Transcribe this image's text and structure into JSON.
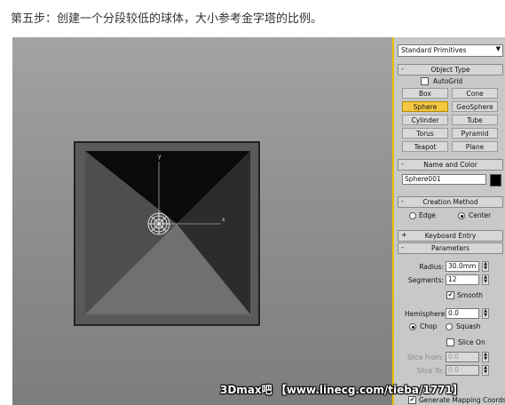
{
  "caption": "第五步：创建一个分段较低的球体，大小参考金字塔的比例。",
  "watermark": "3Dmax吧 【www.linecg.com/tieba/1771】",
  "viewport": {
    "axis_y": "y",
    "axis_x": "x"
  },
  "panel": {
    "dropdown": "Standard Primitives",
    "object_type": {
      "title": "Object Type",
      "autogrid": "AutoGrid",
      "buttons": [
        "Box",
        "Cone",
        "Sphere",
        "GeoSphere",
        "Cylinder",
        "Tube",
        "Torus",
        "Pyramid",
        "Teapot",
        "Plane"
      ],
      "active": "Sphere"
    },
    "name_color": {
      "title": "Name and Color",
      "name": "Sphere001",
      "color": "#000000"
    },
    "creation_method": {
      "title": "Creation Method",
      "edge": "Edge",
      "center": "Center",
      "selected": "Center"
    },
    "keyboard_entry": {
      "title": "Keyboard Entry"
    },
    "parameters": {
      "title": "Parameters",
      "radius_label": "Radius:",
      "radius": "30.0mm",
      "segments_label": "Segments:",
      "segments": "12",
      "smooth": "Smooth",
      "hemisphere_label": "Hemisphere:",
      "hemisphere": "0.0",
      "chop": "Chop",
      "squash": "Squash",
      "slice_on": "Slice On",
      "slice_from_label": "Slice From:",
      "slice_from": "0.0",
      "slice_to_label": "Slice To:",
      "slice_to": "0.0",
      "gen_map": "Generate Mapping Coords"
    },
    "minus": "-",
    "plus": "+"
  }
}
